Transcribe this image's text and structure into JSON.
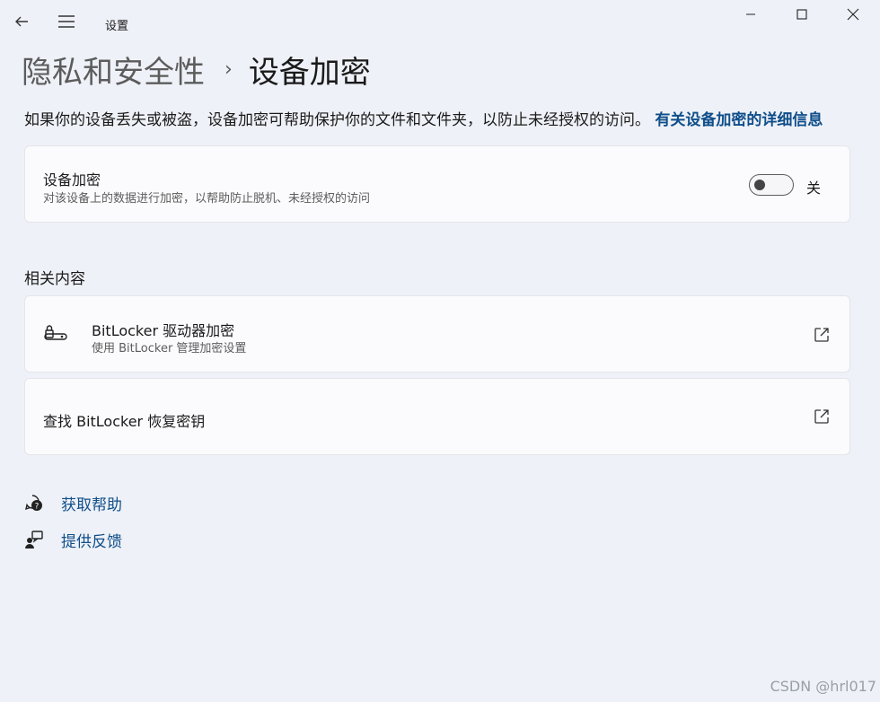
{
  "window": {
    "app_title": "设置"
  },
  "breadcrumb": {
    "parent": "隐私和安全性",
    "separator": "›",
    "current": "设备加密"
  },
  "description": {
    "text": "如果你的设备丢失或被盗，设备加密可帮助保护你的文件和文件夹，以防止未经授权的访问。",
    "link": "有关设备加密的详细信息"
  },
  "encryption_card": {
    "title": "设备加密",
    "subtitle": "对该设备上的数据进行加密，以帮助防止脱机、未经授权的访问",
    "toggle_state": "关",
    "toggle_on": false
  },
  "related": {
    "heading": "相关内容",
    "items": [
      {
        "title": "BitLocker 驱动器加密",
        "subtitle": "使用 BitLocker 管理加密设置",
        "icon": "bitlocker-key-icon",
        "action_icon": "open-external-icon"
      },
      {
        "title": "查找 BitLocker 恢复密钥",
        "icon": "",
        "action_icon": "open-external-icon"
      }
    ]
  },
  "help_links": [
    {
      "label": "获取帮助",
      "icon": "help-chat-icon"
    },
    {
      "label": "提供反馈",
      "icon": "feedback-person-icon"
    }
  ],
  "watermark": "CSDN @hrl017"
}
